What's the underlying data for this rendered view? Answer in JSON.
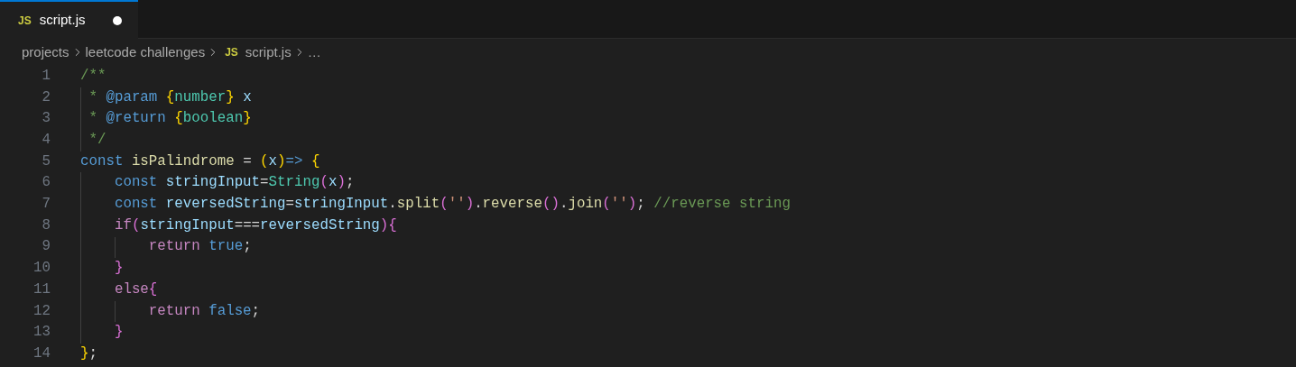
{
  "tabs": [
    {
      "icon_text": "JS",
      "label": "script.js",
      "selected": true,
      "modified": true
    }
  ],
  "breadcrumb": [
    {
      "label": "projects",
      "kind": "folder"
    },
    {
      "label": "leetcode challenges",
      "kind": "folder"
    },
    {
      "label": "script.js",
      "kind": "file",
      "icon_text": "JS"
    },
    {
      "label": "…",
      "kind": "more"
    }
  ],
  "editor": {
    "lines": [
      {
        "number": "1",
        "tokens": [
          {
            "text": "/**",
            "kind": "comment"
          }
        ]
      },
      {
        "number": "2",
        "tokens": [
          {
            "text": " * ",
            "kind": "comment"
          },
          {
            "text": "@param ",
            "kind": "tag"
          },
          {
            "text": "{",
            "kind": "outerbracket"
          },
          {
            "text": "number",
            "kind": "type"
          },
          {
            "text": "}",
            "kind": "outerbracket"
          },
          {
            "text": " x",
            "kind": "variable"
          }
        ]
      },
      {
        "number": "3",
        "tokens": [
          {
            "text": " * ",
            "kind": "comment"
          },
          {
            "text": "@return ",
            "kind": "tag"
          },
          {
            "text": "{",
            "kind": "outerbracket"
          },
          {
            "text": "boolean",
            "kind": "type"
          },
          {
            "text": "}",
            "kind": "outerbracket"
          }
        ]
      },
      {
        "number": "4",
        "tokens": [
          {
            "text": " */",
            "kind": "comment"
          }
        ]
      },
      {
        "number": "5",
        "tokens": [
          {
            "text": "const ",
            "kind": "keyword"
          },
          {
            "text": "isPalindrome",
            "kind": "function"
          },
          {
            "text": " = ",
            "kind": "plain"
          },
          {
            "text": "(",
            "kind": "outerbracket"
          },
          {
            "text": "x",
            "kind": "variable"
          },
          {
            "text": ")",
            "kind": "outerbracket"
          },
          {
            "text": "=> ",
            "kind": "keyword"
          },
          {
            "text": "{",
            "kind": "outerbracket"
          }
        ]
      },
      {
        "number": "6",
        "tokens": [
          {
            "text": "    const",
            "kind": "keyword"
          },
          {
            "text": " stringInput",
            "kind": "variable"
          },
          {
            "text": "=",
            "kind": "plain"
          },
          {
            "text": "String",
            "kind": "type"
          },
          {
            "text": "(",
            "kind": "innerbracket"
          },
          {
            "text": "x",
            "kind": "variable"
          },
          {
            "text": ")",
            "kind": "innerbracket"
          },
          {
            "text": ";",
            "kind": "plain"
          }
        ]
      },
      {
        "number": "7",
        "tokens": [
          {
            "text": "    const",
            "kind": "keyword"
          },
          {
            "text": " reversedString",
            "kind": "variable"
          },
          {
            "text": "=",
            "kind": "plain"
          },
          {
            "text": "stringInput",
            "kind": "variable"
          },
          {
            "text": ".",
            "kind": "plain"
          },
          {
            "text": "split",
            "kind": "function"
          },
          {
            "text": "(",
            "kind": "innerbracket"
          },
          {
            "text": "''",
            "kind": "string"
          },
          {
            "text": ")",
            "kind": "innerbracket"
          },
          {
            "text": ".",
            "kind": "plain"
          },
          {
            "text": "reverse",
            "kind": "function"
          },
          {
            "text": "()",
            "kind": "innerbracket"
          },
          {
            "text": ".",
            "kind": "plain"
          },
          {
            "text": "join",
            "kind": "function"
          },
          {
            "text": "(",
            "kind": "innerbracket"
          },
          {
            "text": "''",
            "kind": "string"
          },
          {
            "text": ")",
            "kind": "innerbracket"
          },
          {
            "text": "; ",
            "kind": "plain"
          },
          {
            "text": "//reverse string",
            "kind": "comment"
          }
        ]
      },
      {
        "number": "8",
        "tokens": [
          {
            "text": "    if",
            "kind": "control"
          },
          {
            "text": "(",
            "kind": "innerbracket"
          },
          {
            "text": "stringInput",
            "kind": "variable"
          },
          {
            "text": "===",
            "kind": "plain"
          },
          {
            "text": "reversedString",
            "kind": "variable"
          },
          {
            "text": ")",
            "kind": "innerbracket"
          },
          {
            "text": "{",
            "kind": "innerbracket"
          }
        ]
      },
      {
        "number": "9",
        "tokens": [
          {
            "text": "        return ",
            "kind": "control"
          },
          {
            "text": "true",
            "kind": "keyword"
          },
          {
            "text": ";",
            "kind": "plain"
          }
        ]
      },
      {
        "number": "10",
        "tokens": [
          {
            "text": "    }",
            "kind": "innerbracket"
          }
        ]
      },
      {
        "number": "11",
        "tokens": [
          {
            "text": "    else",
            "kind": "control"
          },
          {
            "text": "{",
            "kind": "innerbracket"
          }
        ]
      },
      {
        "number": "12",
        "tokens": [
          {
            "text": "        return ",
            "kind": "control"
          },
          {
            "text": "false",
            "kind": "keyword"
          },
          {
            "text": ";",
            "kind": "plain"
          }
        ]
      },
      {
        "number": "13",
        "tokens": [
          {
            "text": "    }",
            "kind": "innerbracket"
          }
        ]
      },
      {
        "number": "14",
        "tokens": [
          {
            "text": "}",
            "kind": "outerbracket"
          },
          {
            "text": ";",
            "kind": "plain"
          }
        ]
      }
    ]
  }
}
